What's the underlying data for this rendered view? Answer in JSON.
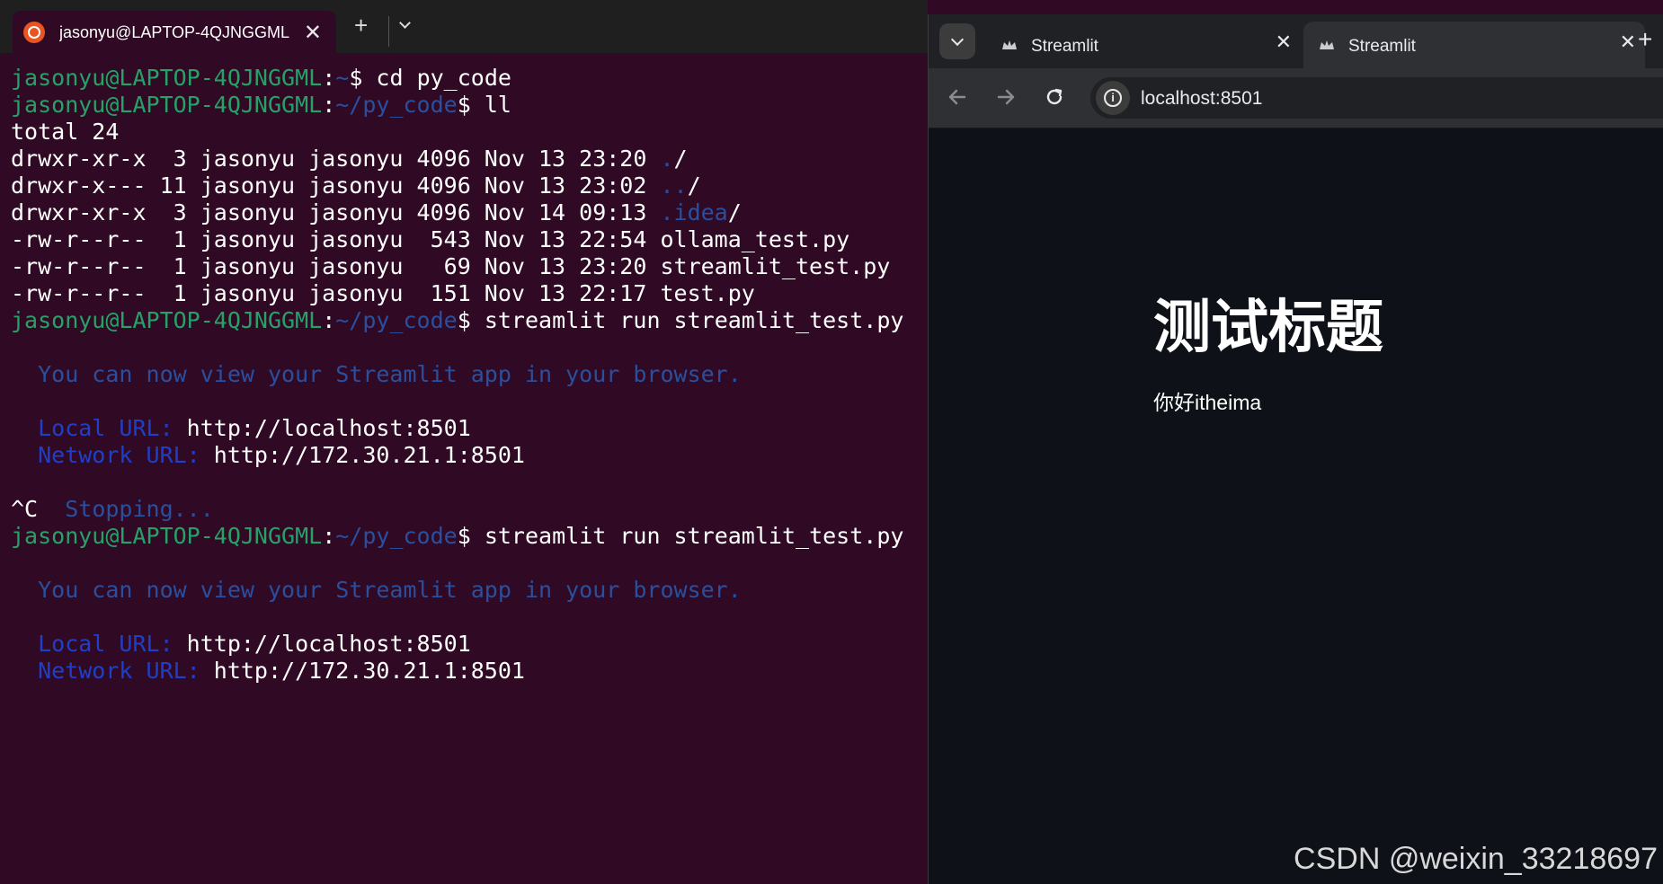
{
  "terminal": {
    "tab_title": "jasonyu@LAPTOP-4QJNGGML",
    "lines": [
      {
        "prompt_user": "jasonyu@LAPTOP-4QJNGGML",
        "prompt_sep": ":",
        "prompt_path": "~",
        "prompt_end": "$",
        "command": " cd py_code"
      },
      {
        "prompt_user": "jasonyu@LAPTOP-4QJNGGML",
        "prompt_sep": ":",
        "prompt_path": "~/py_code",
        "prompt_end": "$",
        "command": " ll"
      },
      {
        "text": "total 24"
      },
      {
        "text": "drwxr-xr-x  3 jasonyu jasonyu 4096 Nov 13 23:20 ",
        "dir": ".",
        "suffix": "/"
      },
      {
        "text": "drwxr-x--- 11 jasonyu jasonyu 4096 Nov 13 23:02 ",
        "dir": "..",
        "suffix": "/"
      },
      {
        "text": "drwxr-xr-x  3 jasonyu jasonyu 4096 Nov 14 09:13 ",
        "dir": ".idea",
        "suffix": "/"
      },
      {
        "text": "-rw-r--r--  1 jasonyu jasonyu  543 Nov 13 22:54 ollama_test.py"
      },
      {
        "text": "-rw-r--r--  1 jasonyu jasonyu   69 Nov 13 23:20 streamlit_test.py"
      },
      {
        "text": "-rw-r--r--  1 jasonyu jasonyu  151 Nov 13 22:17 test.py"
      },
      {
        "prompt_user": "jasonyu@LAPTOP-4QJNGGML",
        "prompt_sep": ":",
        "prompt_path": "~/py_code",
        "prompt_end": "$",
        "command": " streamlit run streamlit_test.py"
      },
      {
        "text": ""
      },
      {
        "info": "  You can now view your Streamlit app in your browser."
      },
      {
        "text": ""
      },
      {
        "label": "  Local URL: ",
        "value": "http://localhost:8501"
      },
      {
        "label": "  Network URL: ",
        "value": "http://172.30.21.1:8501"
      },
      {
        "text": ""
      },
      {
        "text": "^C  ",
        "info": "Stopping..."
      },
      {
        "prompt_user": "jasonyu@LAPTOP-4QJNGGML",
        "prompt_sep": ":",
        "prompt_path": "~/py_code",
        "prompt_end": "$",
        "command": " streamlit run streamlit_test.py"
      },
      {
        "text": ""
      },
      {
        "info": "  You can now view your Streamlit app in your browser."
      },
      {
        "text": ""
      },
      {
        "label": "  Local URL: ",
        "value": "http://localhost:8501"
      },
      {
        "label": "  Network URL: ",
        "value": "http://172.30.21.1:8501"
      }
    ]
  },
  "browser": {
    "tabs": [
      {
        "title": "Streamlit",
        "active": false
      },
      {
        "title": "Streamlit",
        "active": true
      }
    ],
    "url": "localhost:8501",
    "page": {
      "title": "测试标题",
      "text": "你好itheima"
    }
  },
  "watermark": "CSDN @weixin_33218697",
  "colors": {
    "terminal_bg": "#300a24",
    "prompt_green": "#26a269",
    "path_blue": "#2a4f9e",
    "streamlit_bg": "#0e1117"
  },
  "icons": {
    "terminal_tab": "ubuntu-logo-icon",
    "browser_tab": "streamlit-crown-icon",
    "omnibox": "info-icon"
  }
}
